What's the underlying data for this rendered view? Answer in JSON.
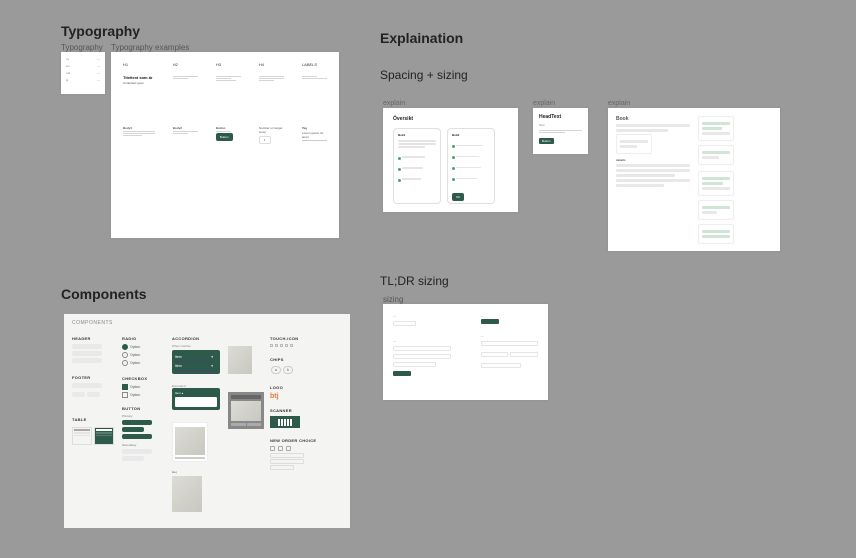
{
  "sections": {
    "typography_title": "Typography",
    "explanation_title": "Explaination",
    "spacing_title": "Spacing + sizing",
    "tldr_title": "TL;DR sizing",
    "components_title": "Components"
  },
  "frame_labels": {
    "typo_small": "Typography",
    "typo_big": "Typography examples",
    "expl1": "explain",
    "expl2": "explain",
    "expl3": "explain",
    "tldr": "sizing"
  },
  "typo_small_rows": [
    {
      "a": "xs",
      "b": "—"
    },
    {
      "a": "sm",
      "b": "—"
    },
    {
      "a": "md",
      "b": "—"
    },
    {
      "a": "lg",
      "b": "—"
    }
  ],
  "typo_big": {
    "cols": [
      "H1",
      "H2",
      "H3",
      "H4",
      "LABELS"
    ],
    "r1_lead": "Titeltext som är",
    "r1_sub": "Undertitel typen",
    "body_head": "Body1",
    "body2_head": "Body2",
    "button_head": "Button",
    "button_txt": "Button",
    "num_head": "Number on target cover",
    "num_box": "1",
    "tag_head": "Tag",
    "lorem_short": "Lorem ipsum sit amet"
  },
  "expl1": {
    "title": "Översikt",
    "ph1": "Bok1",
    "ph2": "Bok2"
  },
  "expl2": {
    "title": "HeadText",
    "sub": "Text",
    "btn": "Button"
  },
  "expl3": {
    "title": "Book",
    "sub": "details"
  },
  "components": {
    "panel_title": "COMPONENTS",
    "groups": {
      "header": "HEADER",
      "footer": "FOOTER",
      "table": "TABLE",
      "radio": "RADIO",
      "checkbox": "CHECKBOX",
      "button": "BUTTON",
      "accordion": "ACCORDION",
      "touch": "TOUCH-ICON",
      "chips": "CHIPS",
      "logo": "LOGO",
      "scanner": "SCANNER",
      "order": "NEW ORDER CHOICE"
    },
    "radio_opts": [
      "Option",
      "Option",
      "Option"
    ],
    "chk_opts": [
      "Option",
      "Option"
    ],
    "acc_items": [
      "When inactive",
      "Item",
      "Item"
    ],
    "logo_text": "btj"
  }
}
